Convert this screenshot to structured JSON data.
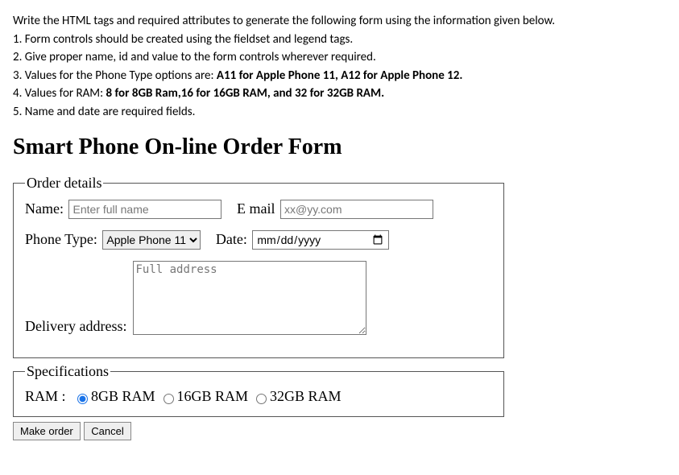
{
  "intro": {
    "line1": "Write the HTML tags and required attributes to generate the following form using the information given below.",
    "line2": "1. Form controls should be created using the fieldset and legend tags.",
    "line3": "2. Give proper name, id and value to the form controls wherever required.",
    "line4_prefix": "3. Values for the Phone Type options are: ",
    "line4_bold": "A11 for Apple Phone 11, A12 for Apple Phone 12.",
    "line5_prefix": "4. Values for RAM: ",
    "line5_bold": "8 for 8GB Ram,16 for 16GB RAM, and 32 for 32GB RAM.",
    "line6": "5.  Name and date are required fields."
  },
  "form": {
    "title": "Smart Phone On-line Order Form",
    "fieldset1": {
      "legend": "Order details",
      "name_label": "Name:",
      "name_placeholder": "Enter full name",
      "email_label": "E mail",
      "email_placeholder": "xx@yy.com",
      "phone_type_label": "Phone Type:",
      "phone_type_options": [
        {
          "value": "A11",
          "text": "Apple Phone 11"
        },
        {
          "value": "A12",
          "text": "Apple Phone 12"
        }
      ],
      "phone_type_selected": "Apple Phone 11",
      "date_label": "Date:",
      "date_placeholder": "mm/dd/yyyy",
      "delivery_label": "Delivery address:",
      "delivery_placeholder": "Full address"
    },
    "fieldset2": {
      "legend": "Specifications",
      "ram_label": "RAM :",
      "ram_options": [
        {
          "value": "8",
          "text": "8GB RAM",
          "checked": true
        },
        {
          "value": "16",
          "text": "16GB RAM",
          "checked": false
        },
        {
          "value": "32",
          "text": "32GB RAM",
          "checked": false
        }
      ]
    },
    "buttons": {
      "submit": "Make order",
      "reset": "Cancel"
    }
  }
}
